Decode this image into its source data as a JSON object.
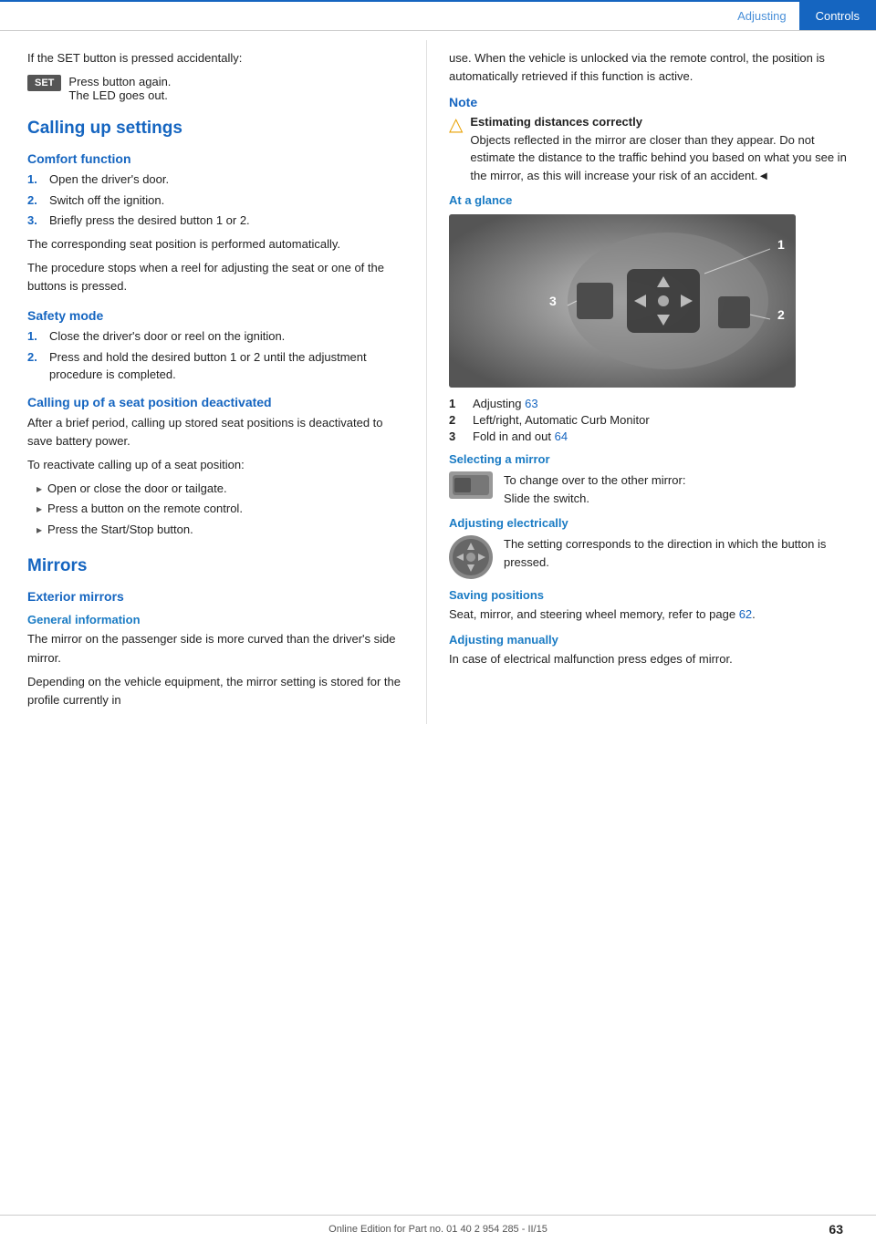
{
  "header": {
    "adjusting": "Adjusting",
    "controls": "Controls"
  },
  "intro": {
    "set_button_text": "If the SET button is pressed accidentally:",
    "set_label": "SET",
    "set_instructions": [
      "Press button again.",
      "The LED goes out."
    ]
  },
  "calling_up_settings": {
    "title": "Calling up settings"
  },
  "comfort_function": {
    "title": "Comfort function",
    "steps": [
      "Open the driver's door.",
      "Switch off the ignition.",
      "Briefly press the desired button 1 or 2."
    ],
    "para1": "The corresponding seat position is performed automatically.",
    "para2": "The procedure stops when a reel for adjusting the seat or one of the buttons is pressed."
  },
  "safety_mode": {
    "title": "Safety mode",
    "steps": [
      "Close the driver's door or reel on the ignition.",
      "Press and hold the desired button 1 or 2 until the adjustment procedure is completed."
    ]
  },
  "calling_up_deactivated": {
    "title": "Calling up of a seat position deactivated",
    "para1": "After a brief period, calling up stored seat positions is deactivated to save battery power.",
    "para2": "To reactivate calling up of a seat position:",
    "bullets": [
      "Open or close the door or tailgate.",
      "Press a button on the remote control.",
      "Press the Start/Stop button."
    ]
  },
  "mirrors": {
    "title": "Mirrors",
    "exterior_mirrors": {
      "title": "Exterior mirrors",
      "general_information": {
        "title": "General information",
        "para1": "The mirror on the passenger side is more curved than the driver's side mirror.",
        "para2": "Depending on the vehicle equipment, the mirror setting is stored for the profile currently in"
      }
    }
  },
  "right_col": {
    "right_intro": "use. When the vehicle is unlocked via the remote control, the position is automatically retrieved if this function is active.",
    "note": {
      "title": "Note",
      "warning_text": "Estimating distances correctly",
      "warning_body": "Objects reflected in the mirror are closer than they appear. Do not estimate the distance to the traffic behind you based on what you see in the mirror, as this will increase your risk of an accident.◄"
    },
    "at_a_glance": {
      "title": "At a glance",
      "items": [
        {
          "num": "1",
          "text": "Adjusting",
          "link": "63"
        },
        {
          "num": "2",
          "text": "Left/right, Automatic Curb Monitor",
          "link": ""
        },
        {
          "num": "3",
          "text": "Fold in and out",
          "link": "64"
        }
      ]
    },
    "selecting_mirror": {
      "title": "Selecting a mirror",
      "text1": "To change over to the other mirror:",
      "text2": "Slide the switch."
    },
    "adjusting_electrically": {
      "title": "Adjusting electrically",
      "text": "The setting corresponds to the direction in which the button is pressed."
    },
    "saving_positions": {
      "title": "Saving positions",
      "text": "Seat, mirror, and steering wheel memory, refer to page",
      "link": "62",
      "text_after": "."
    },
    "adjusting_manually": {
      "title": "Adjusting manually",
      "text": "In case of electrical malfunction press edges of mirror."
    }
  },
  "footer": {
    "text": "Online Edition for Part no. 01 40 2 954 285 - II/15",
    "page": "63"
  }
}
